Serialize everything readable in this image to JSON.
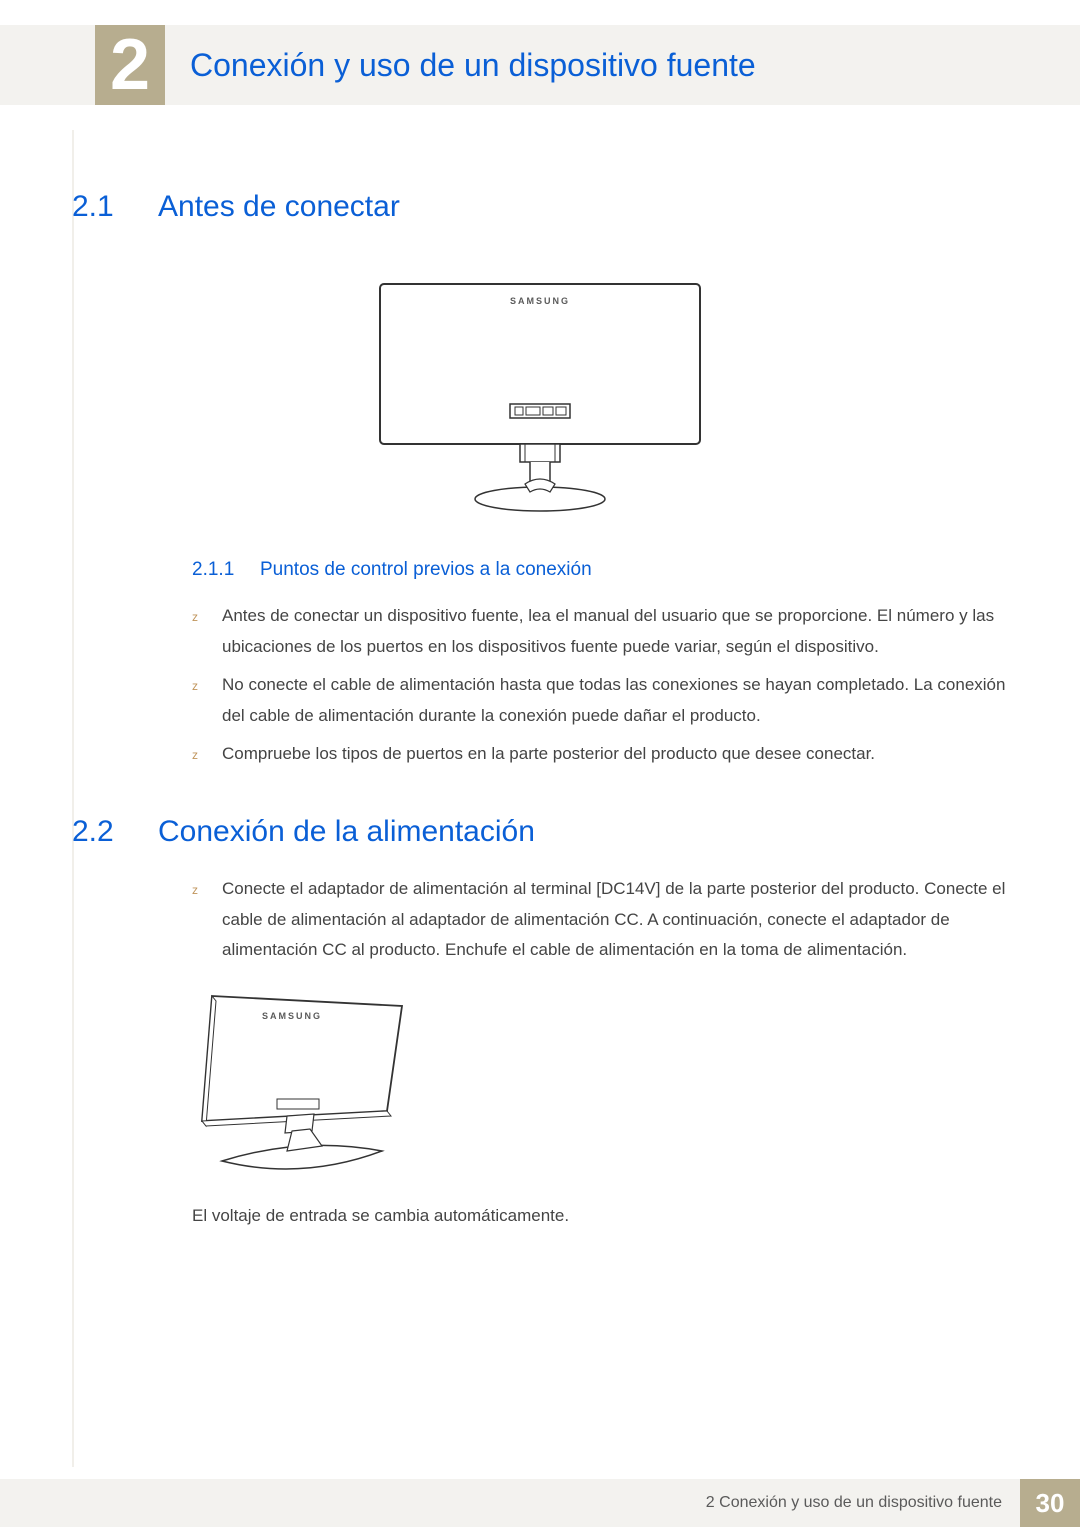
{
  "chapter": {
    "number": "2",
    "title": "Conexión y uso de un dispositivo fuente"
  },
  "section21": {
    "num": "2.1",
    "title": "Antes de conectar"
  },
  "fig1_brand": "SAMSUNG",
  "section211": {
    "num": "2.1.1",
    "title": "Puntos de control previos a la conexión"
  },
  "bullets211": [
    "Antes de conectar un dispositivo fuente, lea el manual del usuario que se proporcione. El número y las ubicaciones de los puertos en los dispositivos fuente puede variar, según el dispositivo.",
    "No conecte el cable de alimentación hasta que todas las conexiones se hayan completado. La conexión del cable de alimentación durante la conexión puede dañar el producto.",
    "Compruebe los tipos de puertos en la parte posterior del producto que desee conectar."
  ],
  "section22": {
    "num": "2.2",
    "title": "Conexión de la alimentación"
  },
  "bullets22": [
    "Conecte el adaptador de alimentación al terminal [DC14V] de la parte posterior del producto. Conecte el cable de alimentación al adaptador de alimentación CC. A continuación, conecte el adaptador de alimentación CC al producto. Enchufe el cable de alimentación en la toma de alimentación."
  ],
  "fig2_brand": "SAMSUNG",
  "after_fig2": "El voltaje de entrada se cambia automáticamente.",
  "footer": {
    "text": "2 Conexión y uso de un dispositivo fuente",
    "page": "30"
  }
}
